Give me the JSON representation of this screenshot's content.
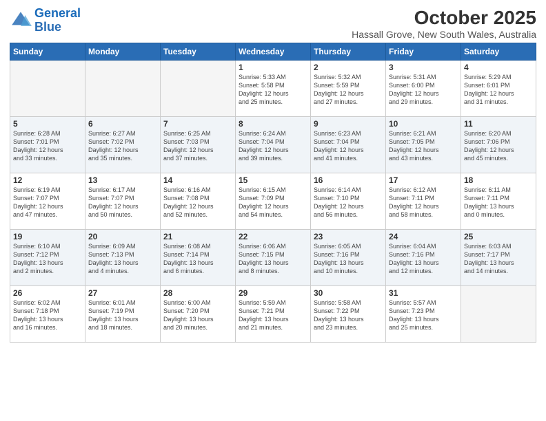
{
  "header": {
    "logo_line1": "General",
    "logo_line2": "Blue",
    "title": "October 2025",
    "subtitle": "Hassall Grove, New South Wales, Australia"
  },
  "weekdays": [
    "Sunday",
    "Monday",
    "Tuesday",
    "Wednesday",
    "Thursday",
    "Friday",
    "Saturday"
  ],
  "weeks": [
    [
      {
        "day": "",
        "info": ""
      },
      {
        "day": "",
        "info": ""
      },
      {
        "day": "",
        "info": ""
      },
      {
        "day": "1",
        "info": "Sunrise: 5:33 AM\nSunset: 5:58 PM\nDaylight: 12 hours\nand 25 minutes."
      },
      {
        "day": "2",
        "info": "Sunrise: 5:32 AM\nSunset: 5:59 PM\nDaylight: 12 hours\nand 27 minutes."
      },
      {
        "day": "3",
        "info": "Sunrise: 5:31 AM\nSunset: 6:00 PM\nDaylight: 12 hours\nand 29 minutes."
      },
      {
        "day": "4",
        "info": "Sunrise: 5:29 AM\nSunset: 6:01 PM\nDaylight: 12 hours\nand 31 minutes."
      }
    ],
    [
      {
        "day": "5",
        "info": "Sunrise: 6:28 AM\nSunset: 7:01 PM\nDaylight: 12 hours\nand 33 minutes."
      },
      {
        "day": "6",
        "info": "Sunrise: 6:27 AM\nSunset: 7:02 PM\nDaylight: 12 hours\nand 35 minutes."
      },
      {
        "day": "7",
        "info": "Sunrise: 6:25 AM\nSunset: 7:03 PM\nDaylight: 12 hours\nand 37 minutes."
      },
      {
        "day": "8",
        "info": "Sunrise: 6:24 AM\nSunset: 7:04 PM\nDaylight: 12 hours\nand 39 minutes."
      },
      {
        "day": "9",
        "info": "Sunrise: 6:23 AM\nSunset: 7:04 PM\nDaylight: 12 hours\nand 41 minutes."
      },
      {
        "day": "10",
        "info": "Sunrise: 6:21 AM\nSunset: 7:05 PM\nDaylight: 12 hours\nand 43 minutes."
      },
      {
        "day": "11",
        "info": "Sunrise: 6:20 AM\nSunset: 7:06 PM\nDaylight: 12 hours\nand 45 minutes."
      }
    ],
    [
      {
        "day": "12",
        "info": "Sunrise: 6:19 AM\nSunset: 7:07 PM\nDaylight: 12 hours\nand 47 minutes."
      },
      {
        "day": "13",
        "info": "Sunrise: 6:17 AM\nSunset: 7:07 PM\nDaylight: 12 hours\nand 50 minutes."
      },
      {
        "day": "14",
        "info": "Sunrise: 6:16 AM\nSunset: 7:08 PM\nDaylight: 12 hours\nand 52 minutes."
      },
      {
        "day": "15",
        "info": "Sunrise: 6:15 AM\nSunset: 7:09 PM\nDaylight: 12 hours\nand 54 minutes."
      },
      {
        "day": "16",
        "info": "Sunrise: 6:14 AM\nSunset: 7:10 PM\nDaylight: 12 hours\nand 56 minutes."
      },
      {
        "day": "17",
        "info": "Sunrise: 6:12 AM\nSunset: 7:11 PM\nDaylight: 12 hours\nand 58 minutes."
      },
      {
        "day": "18",
        "info": "Sunrise: 6:11 AM\nSunset: 7:11 PM\nDaylight: 13 hours\nand 0 minutes."
      }
    ],
    [
      {
        "day": "19",
        "info": "Sunrise: 6:10 AM\nSunset: 7:12 PM\nDaylight: 13 hours\nand 2 minutes."
      },
      {
        "day": "20",
        "info": "Sunrise: 6:09 AM\nSunset: 7:13 PM\nDaylight: 13 hours\nand 4 minutes."
      },
      {
        "day": "21",
        "info": "Sunrise: 6:08 AM\nSunset: 7:14 PM\nDaylight: 13 hours\nand 6 minutes."
      },
      {
        "day": "22",
        "info": "Sunrise: 6:06 AM\nSunset: 7:15 PM\nDaylight: 13 hours\nand 8 minutes."
      },
      {
        "day": "23",
        "info": "Sunrise: 6:05 AM\nSunset: 7:16 PM\nDaylight: 13 hours\nand 10 minutes."
      },
      {
        "day": "24",
        "info": "Sunrise: 6:04 AM\nSunset: 7:16 PM\nDaylight: 13 hours\nand 12 minutes."
      },
      {
        "day": "25",
        "info": "Sunrise: 6:03 AM\nSunset: 7:17 PM\nDaylight: 13 hours\nand 14 minutes."
      }
    ],
    [
      {
        "day": "26",
        "info": "Sunrise: 6:02 AM\nSunset: 7:18 PM\nDaylight: 13 hours\nand 16 minutes."
      },
      {
        "day": "27",
        "info": "Sunrise: 6:01 AM\nSunset: 7:19 PM\nDaylight: 13 hours\nand 18 minutes."
      },
      {
        "day": "28",
        "info": "Sunrise: 6:00 AM\nSunset: 7:20 PM\nDaylight: 13 hours\nand 20 minutes."
      },
      {
        "day": "29",
        "info": "Sunrise: 5:59 AM\nSunset: 7:21 PM\nDaylight: 13 hours\nand 21 minutes."
      },
      {
        "day": "30",
        "info": "Sunrise: 5:58 AM\nSunset: 7:22 PM\nDaylight: 13 hours\nand 23 minutes."
      },
      {
        "day": "31",
        "info": "Sunrise: 5:57 AM\nSunset: 7:23 PM\nDaylight: 13 hours\nand 25 minutes."
      },
      {
        "day": "",
        "info": ""
      }
    ]
  ]
}
